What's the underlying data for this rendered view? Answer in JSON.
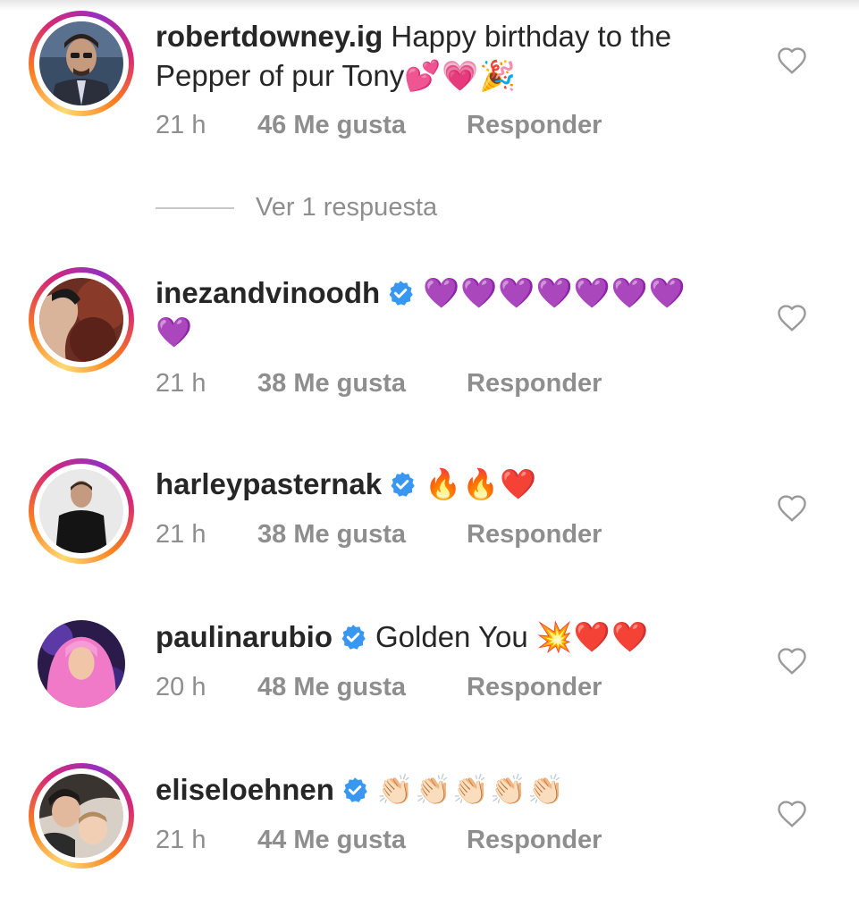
{
  "comments": [
    {
      "username": "robertdowney.ig",
      "verified": false,
      "text_line1": "Happy birthday to the",
      "text_line2": "Pepper of pur Tony",
      "emoji": "💕💗🎉",
      "time": "21 h",
      "likes": "46 Me gusta",
      "reply": "Responder",
      "view_replies": "Ver 1 respuesta"
    },
    {
      "username": "inezandvinoodh",
      "verified": true,
      "emoji_line1": "💜💜💜💜💜💜💜",
      "emoji_line2": "💜",
      "time": "21 h",
      "likes": "38 Me gusta",
      "reply": "Responder"
    },
    {
      "username": "harleypasternak",
      "verified": true,
      "emoji": "🔥🔥❤️",
      "time": "21 h",
      "likes": "38 Me gusta",
      "reply": "Responder"
    },
    {
      "username": "paulinarubio",
      "verified": true,
      "text": "Golden You",
      "emoji": "💥❤️❤️",
      "time": "20 h",
      "likes": "48 Me gusta",
      "reply": "Responder"
    },
    {
      "username": "eliseloehnen",
      "verified": true,
      "emoji": "👏🏻👏🏻👏🏻👏🏻👏🏻",
      "time": "21 h",
      "likes": "44 Me gusta",
      "reply": "Responder"
    }
  ],
  "colors": {
    "text": "#262626",
    "secondary": "#8e8e8e",
    "verified_blue": "#3897f0",
    "heart_stroke": "#999999"
  },
  "icons": {
    "like": "heart-outline-icon",
    "verified": "verified-badge-icon"
  }
}
